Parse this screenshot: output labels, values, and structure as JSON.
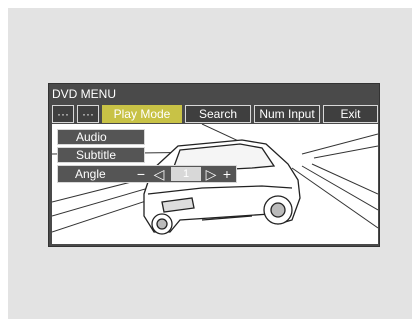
{
  "menu": {
    "title": "DVD MENU",
    "tabs": [
      {
        "label": "···"
      },
      {
        "label": "···"
      },
      {
        "label": "Play Mode"
      },
      {
        "label": "Search"
      },
      {
        "label": "Num Input"
      },
      {
        "label": "Exit"
      }
    ],
    "active_tab": "Play Mode"
  },
  "submenu": {
    "items": [
      {
        "label": "Audio"
      },
      {
        "label": "Subtitle"
      },
      {
        "label": "Angle"
      }
    ]
  },
  "angle_control": {
    "minus": "−",
    "left": "◁",
    "value": "1",
    "right": "▷",
    "plus": "+"
  },
  "colors": {
    "active_tab": "#c8c246",
    "screen_bg": "#4a4a4a",
    "panel_bg": "#e3e3e3"
  }
}
